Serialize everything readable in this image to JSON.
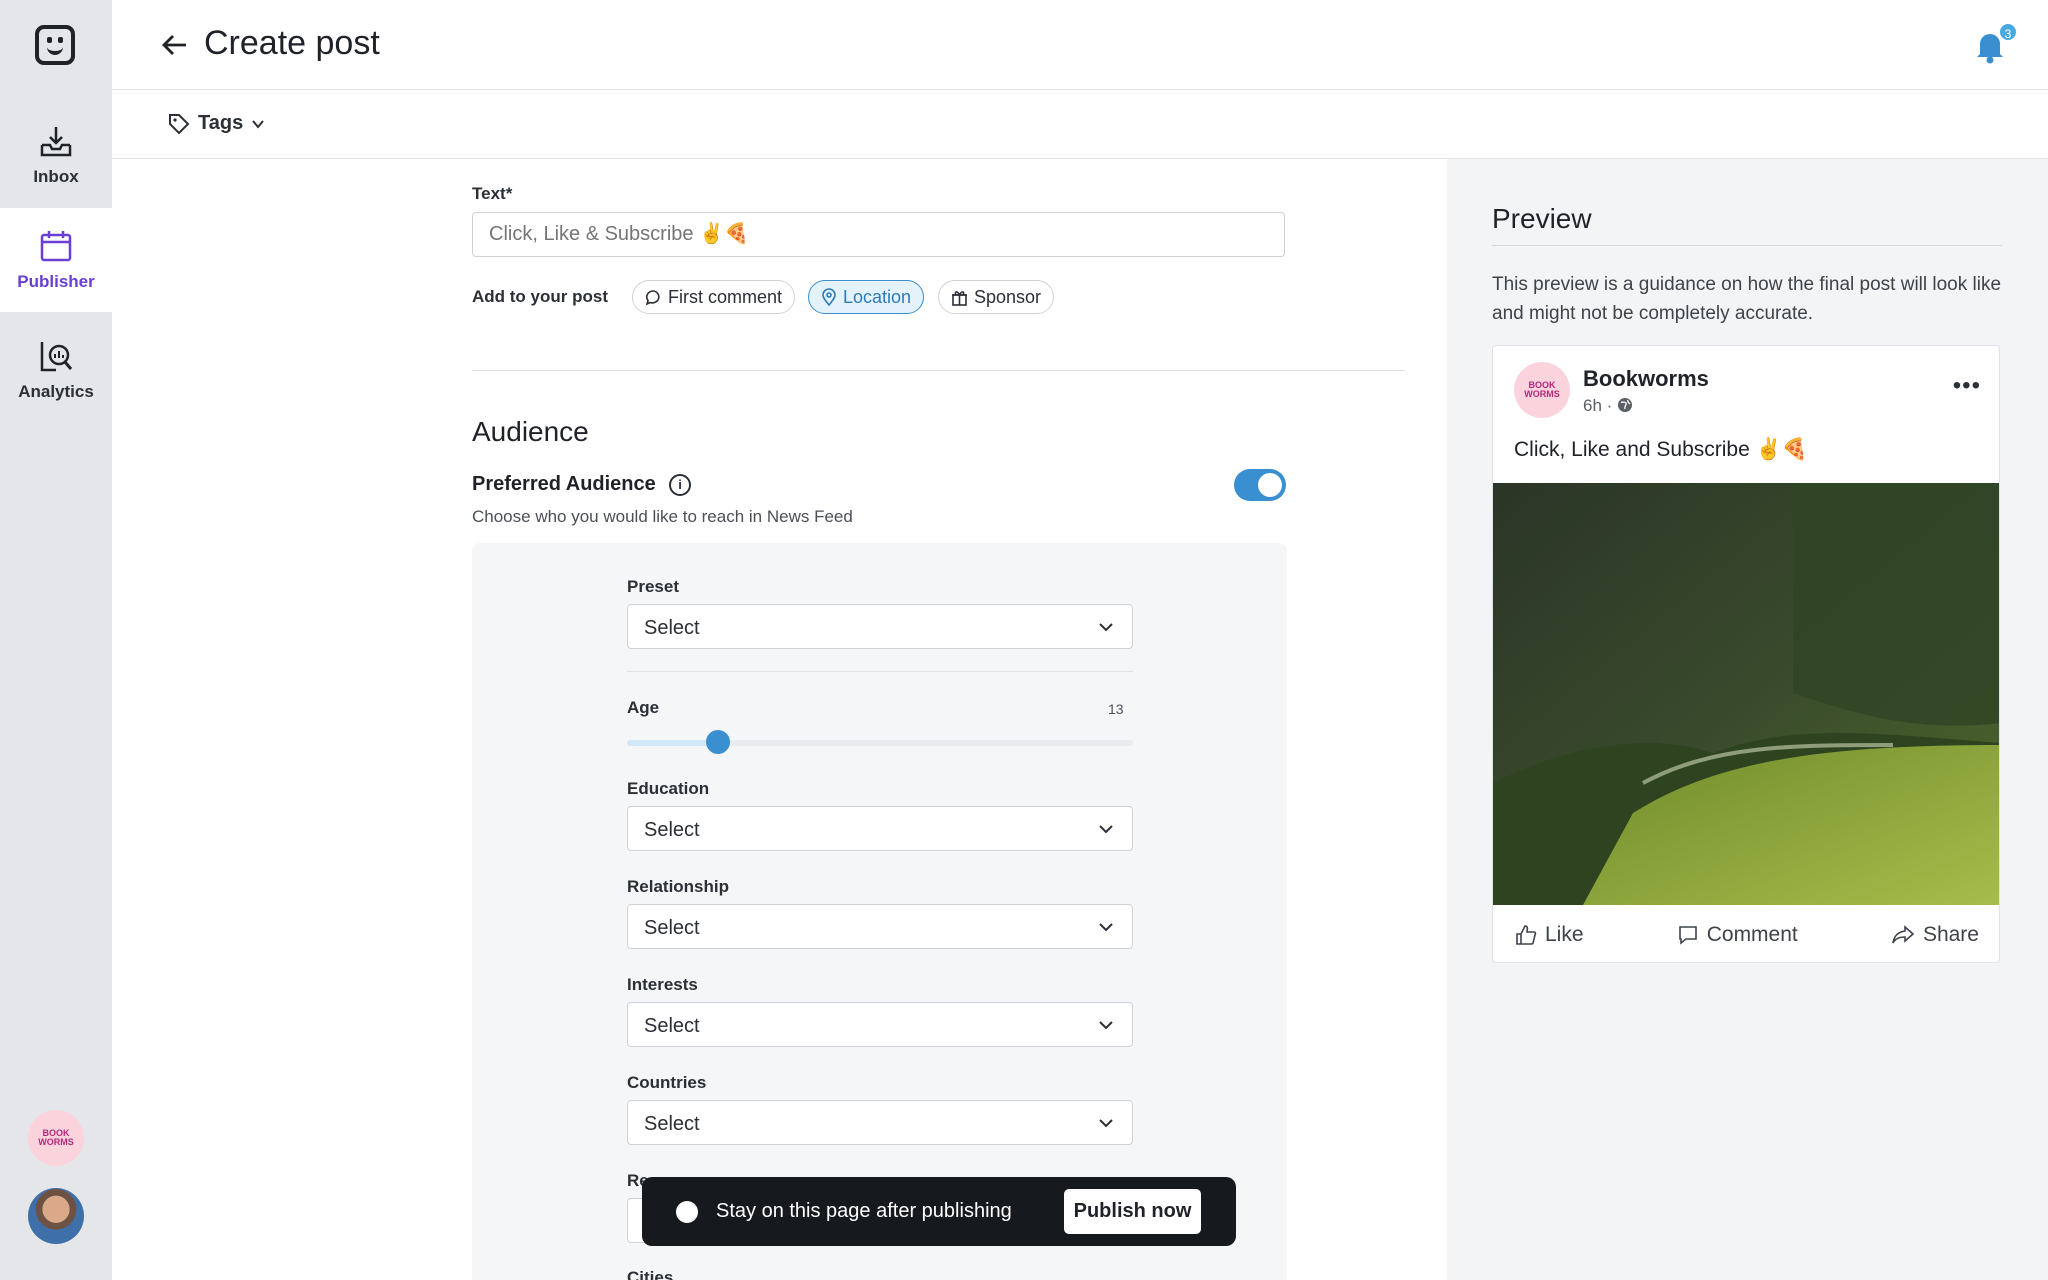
{
  "sidebar": {
    "nav": [
      {
        "label": "Inbox",
        "icon": "inbox-icon"
      },
      {
        "label": "Publisher",
        "icon": "calendar-icon",
        "active": true
      },
      {
        "label": "Analytics",
        "icon": "analytics-icon"
      }
    ],
    "brand_avatar_text": "BOOK WORMS"
  },
  "header": {
    "title": "Create post",
    "notification_count": "3"
  },
  "tagbar": {
    "tags_label": "Tags"
  },
  "form": {
    "text_label": "Text*",
    "text_placeholder": "Click, Like & Subscribe ✌️🍕",
    "add_to_post_label": "Add to your post",
    "chips": [
      {
        "label": "First comment",
        "icon": "comment-icon",
        "active": false
      },
      {
        "label": "Location",
        "icon": "location-pin-icon",
        "active": true
      },
      {
        "label": "Sponsor",
        "icon": "gift-icon",
        "active": false
      }
    ]
  },
  "audience": {
    "section_title": "Audience",
    "preferred_title": "Preferred Audience",
    "preferred_sub": "Choose who you would like to reach in News Feed",
    "preferred_enabled": true,
    "preset_label": "Preset",
    "preset_value": "Select",
    "age_label": "Age",
    "age_value": "13",
    "age_slider_fraction": 0.18,
    "education_label": "Education",
    "education_value": "Select",
    "relationship_label": "Relationship",
    "relationship_value": "Select",
    "interests_label": "Interests",
    "interests_value": "Select",
    "countries_label": "Countries",
    "countries_value": "Select",
    "regions_label_partial": "Re",
    "cities_label_partial": "Cities"
  },
  "publish_bar": {
    "stay_label": "Stay on this page after publishing",
    "publish_label": "Publish now"
  },
  "preview": {
    "title": "Preview",
    "note": "This preview is a guidance on how the final post will look like and might not be completely accurate.",
    "author": "Bookworms",
    "meta": "6h ·",
    "text": "Click, Like and Subscribe ✌️🍕",
    "actions": {
      "like": "Like",
      "comment": "Comment",
      "share": "Share"
    }
  },
  "colors": {
    "accent": "#3a8fd0",
    "publisher": "#6a3fd6",
    "sidebar_bg": "#e4e6ea"
  }
}
